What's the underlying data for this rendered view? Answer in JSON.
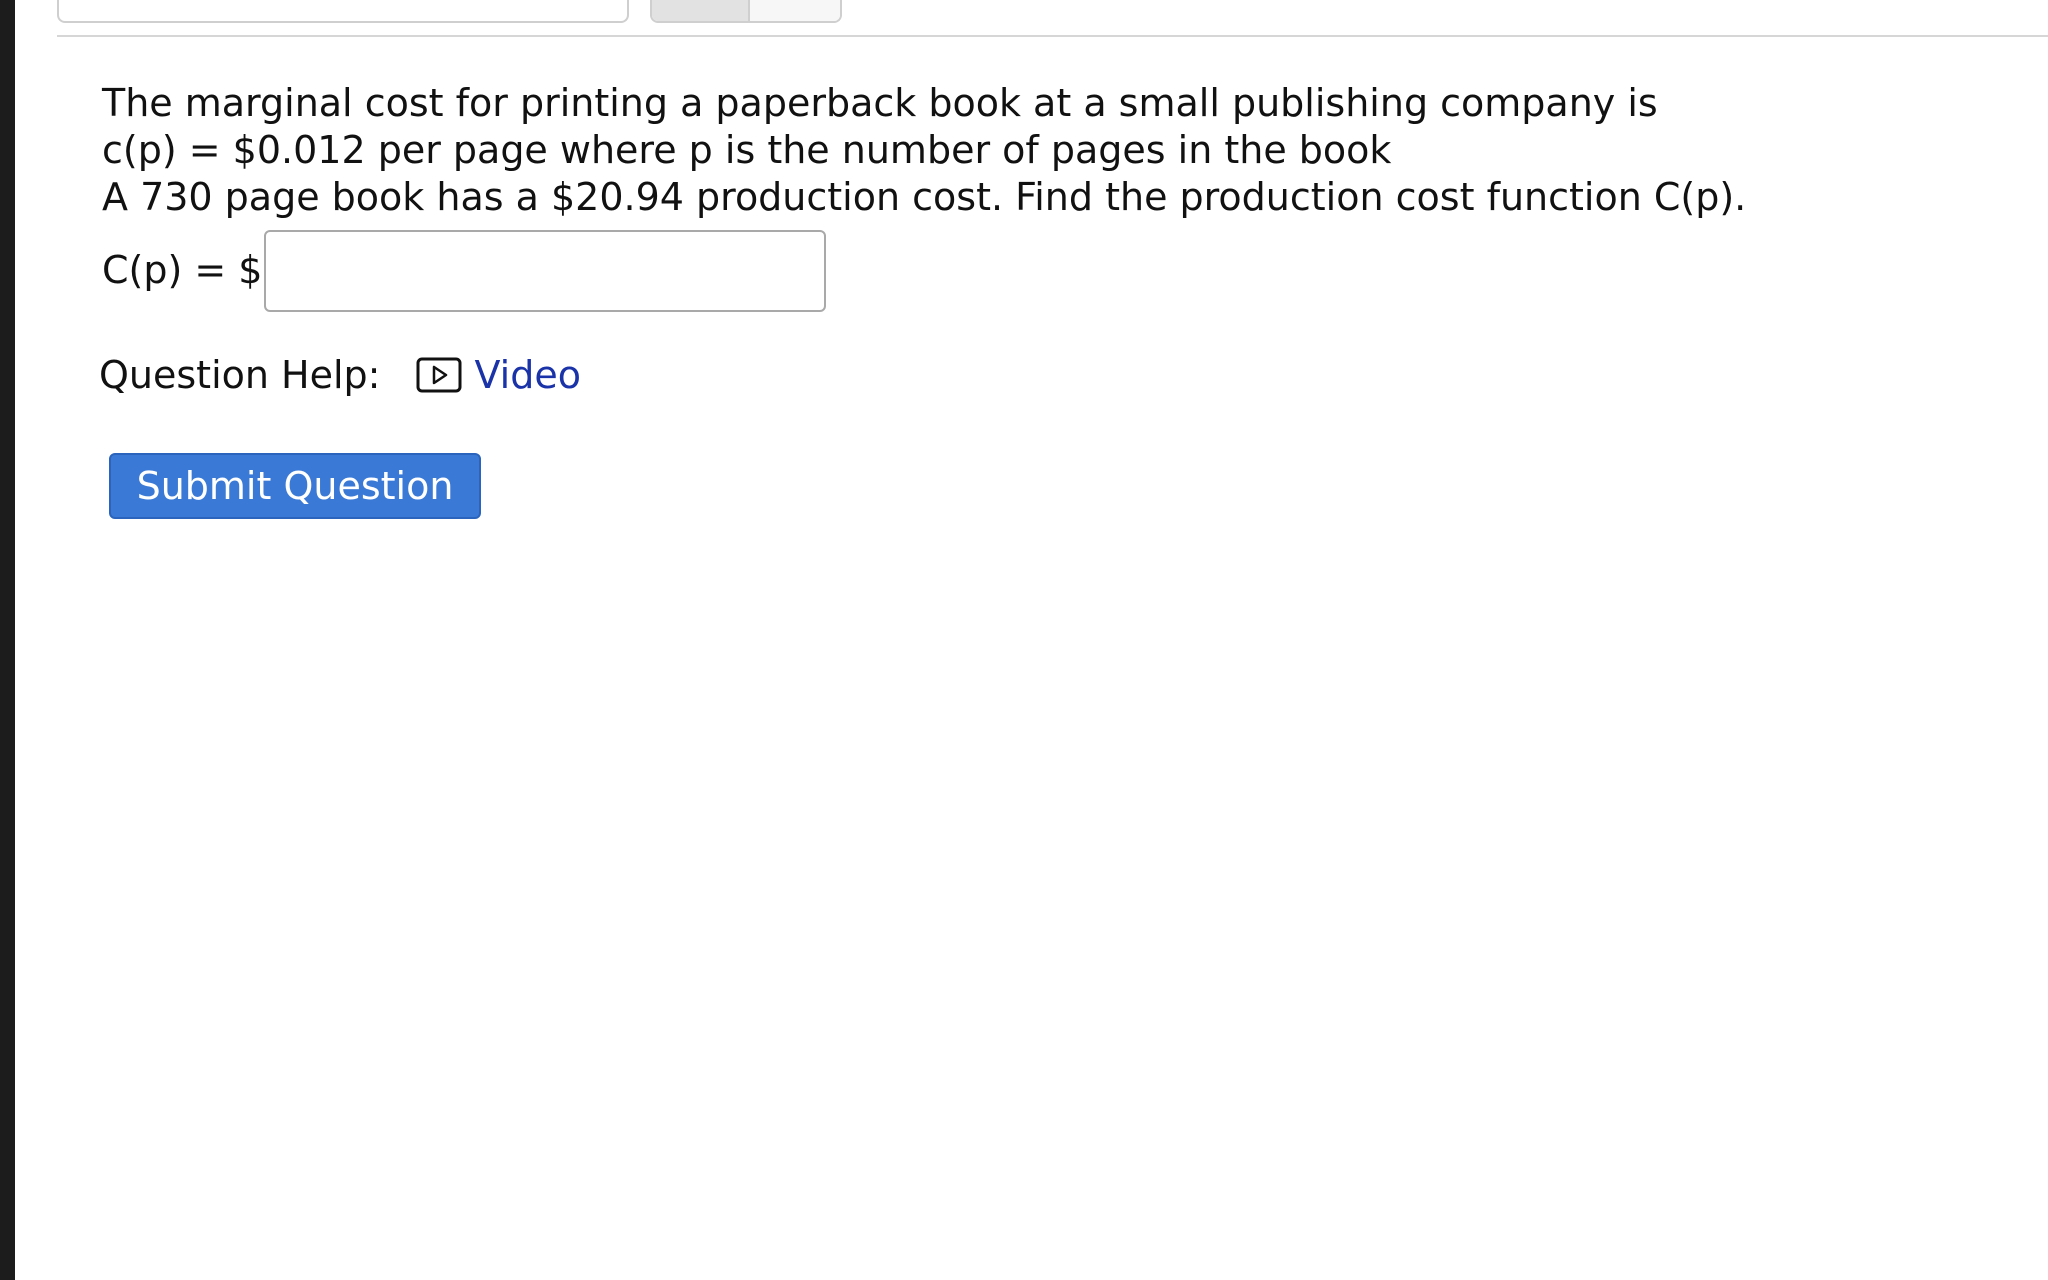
{
  "question": {
    "lines": [
      "The marginal cost for printing a paperback book at a small publishing company is",
      "c(p) = $0.012 per page where p is the number of pages in the book",
      "A 730 page book has a $20.94 production cost. Find the production cost function C(p)."
    ]
  },
  "answer": {
    "label": "C(p) = $",
    "value": "",
    "placeholder": ""
  },
  "help": {
    "label": "Question Help:",
    "video_label": "Video",
    "video_icon": "video-play-icon",
    "link_color": "#1a33a8"
  },
  "submit": {
    "label": "Submit Question",
    "color": "#3a7ad6"
  }
}
